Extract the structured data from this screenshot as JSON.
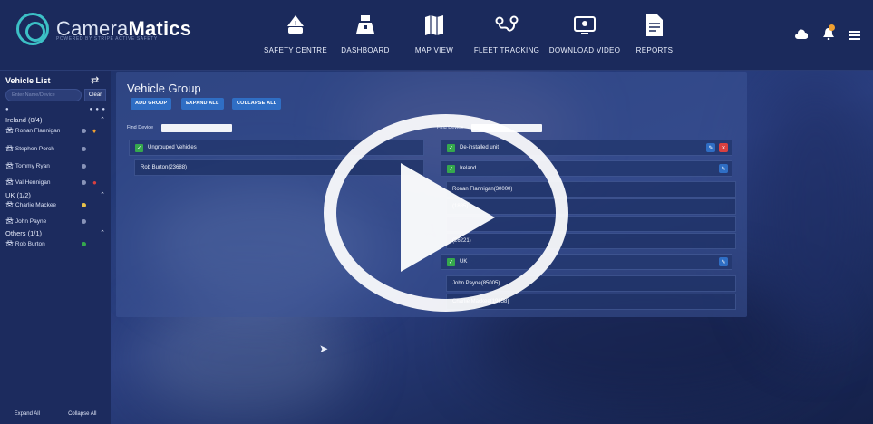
{
  "brand": {
    "name_light": "Camera",
    "name_bold": "Matics",
    "tagline": "POWERED BY STRIPE ACTIVE SAFETY"
  },
  "nav": [
    {
      "label": "SAFETY CENTRE",
      "icon": "car-warning-icon"
    },
    {
      "label": "DASHBOARD",
      "icon": "dashboard-icon"
    },
    {
      "label": "MAP VIEW",
      "icon": "map-icon"
    },
    {
      "label": "FLEET TRACKING",
      "icon": "route-icon"
    },
    {
      "label": "DOWNLOAD VIDEO",
      "icon": "video-download-icon"
    },
    {
      "label": "REPORTS",
      "icon": "report-icon"
    }
  ],
  "sidebar": {
    "title": "Vehicle List",
    "search_placeholder": "Enter Name/Device",
    "clear_label": "Clear",
    "groups": [
      {
        "label": "Ireland (0/4)",
        "vehicles": [
          "Ronan Flannigan",
          "Stephen Porch",
          "Tommy Ryan",
          "Val Hennigan"
        ]
      },
      {
        "label": "UK (1/2)",
        "vehicles": [
          "Charlie Mackee",
          "John Payne"
        ]
      },
      {
        "label": "Others (1/1)",
        "vehicles": [
          "Rob Burton"
        ]
      }
    ],
    "expand_all": "Expand All",
    "collapse_all": "Collapse All"
  },
  "main": {
    "title": "Vehicle Group",
    "buttons": {
      "add": "ADD GROUP",
      "expand": "EXPAND ALL",
      "collapse": "COLLAPSE ALL"
    },
    "find_label": "Find Device",
    "left": {
      "ungrouped": "Ungrouped Vehicles",
      "item": "Rob Burton(23688)"
    },
    "right": {
      "deinstalled": "De-installed unit",
      "ireland": "Ireland",
      "ireland_items": [
        "Ronan Flannigan(30000)",
        "(1885)",
        "",
        "(26221)"
      ],
      "uk": "UK",
      "uk_items": [
        "John Payne(85005)",
        "Charlie Mackee(19658)"
      ]
    }
  },
  "colors": {
    "accent": "#2f6ec4",
    "green": "#35a84d",
    "red": "#d94040",
    "orange": "#f0a030"
  }
}
